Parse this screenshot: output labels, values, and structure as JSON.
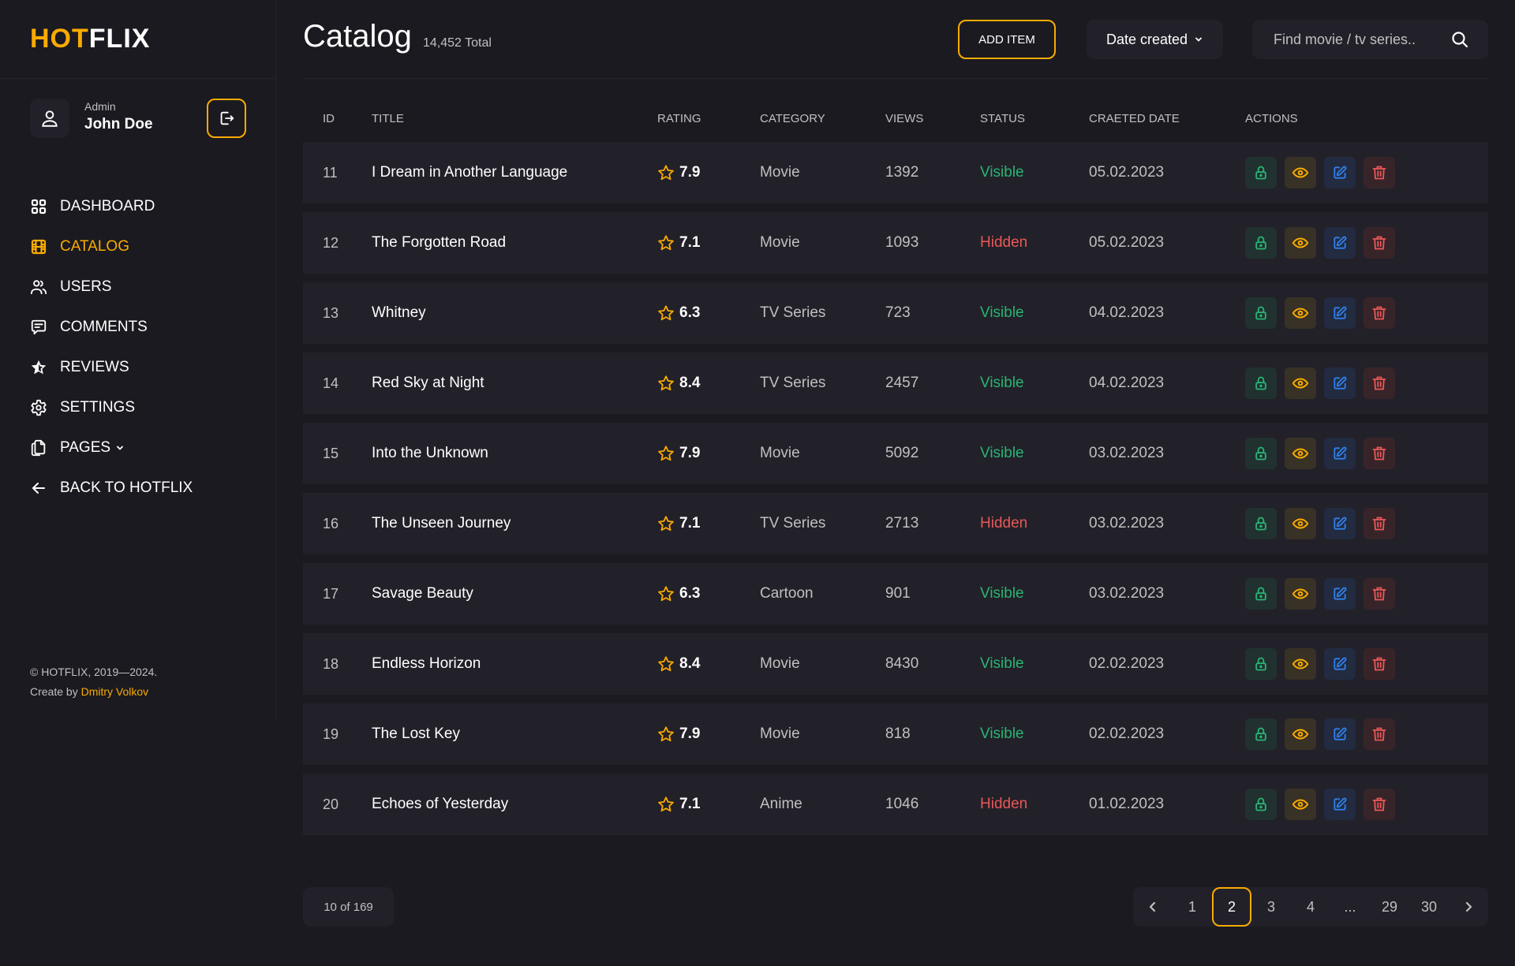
{
  "brand": {
    "part1": "HOT",
    "part2": "FLIX"
  },
  "user": {
    "role": "Admin",
    "name": "John Doe"
  },
  "nav": {
    "items": [
      {
        "label": "DASHBOARD",
        "icon": "dashboard-grid-icon",
        "active": false
      },
      {
        "label": "CATALOG",
        "icon": "film-icon",
        "active": true
      },
      {
        "label": "USERS",
        "icon": "users-icon",
        "active": false
      },
      {
        "label": "COMMENTS",
        "icon": "comment-icon",
        "active": false
      },
      {
        "label": "REVIEWS",
        "icon": "star-half-icon",
        "active": false
      },
      {
        "label": "SETTINGS",
        "icon": "gear-icon",
        "active": false
      },
      {
        "label": "PAGES",
        "icon": "pages-icon",
        "active": false,
        "dropdown": true
      },
      {
        "label": "BACK TO HOTFLIX",
        "icon": "arrow-left-icon",
        "active": false
      }
    ]
  },
  "footer": {
    "copyright": "© HOTFLIX, 2019—2024.",
    "created_prefix": "Create by ",
    "author": "Dmitry Volkov"
  },
  "header": {
    "title": "Catalog",
    "total": "14,452 Total",
    "add_button": "ADD ITEM",
    "sort": {
      "selected": "Date created"
    },
    "search": {
      "placeholder": "Find movie / tv series.."
    }
  },
  "colors": {
    "accent": "#f9ab00",
    "background": "#1b1a20",
    "surface": "#222129",
    "visible": "#29b474",
    "hidden": "#eb5757",
    "edit": "#2f80ed"
  },
  "table": {
    "columns": [
      "ID",
      "TITLE",
      "RATING",
      "CATEGORY",
      "VIEWS",
      "STATUS",
      "CRAETED DATE",
      "ACTIONS"
    ],
    "rows": [
      {
        "id": "11",
        "title": "I Dream in Another Language",
        "rating": "7.9",
        "category": "Movie",
        "views": "1392",
        "status": "Visible",
        "date": "05.02.2023"
      },
      {
        "id": "12",
        "title": "The Forgotten Road",
        "rating": "7.1",
        "category": "Movie",
        "views": "1093",
        "status": "Hidden",
        "date": "05.02.2023"
      },
      {
        "id": "13",
        "title": "Whitney",
        "rating": "6.3",
        "category": "TV Series",
        "views": "723",
        "status": "Visible",
        "date": "04.02.2023"
      },
      {
        "id": "14",
        "title": "Red Sky at Night",
        "rating": "8.4",
        "category": "TV Series",
        "views": "2457",
        "status": "Visible",
        "date": "04.02.2023"
      },
      {
        "id": "15",
        "title": "Into the Unknown",
        "rating": "7.9",
        "category": "Movie",
        "views": "5092",
        "status": "Visible",
        "date": "03.02.2023"
      },
      {
        "id": "16",
        "title": "The Unseen Journey",
        "rating": "7.1",
        "category": "TV Series",
        "views": "2713",
        "status": "Hidden",
        "date": "03.02.2023"
      },
      {
        "id": "17",
        "title": "Savage Beauty",
        "rating": "6.3",
        "category": "Cartoon",
        "views": "901",
        "status": "Visible",
        "date": "03.02.2023"
      },
      {
        "id": "18",
        "title": "Endless Horizon",
        "rating": "8.4",
        "category": "Movie",
        "views": "8430",
        "status": "Visible",
        "date": "02.02.2023"
      },
      {
        "id": "19",
        "title": "The Lost Key",
        "rating": "7.9",
        "category": "Movie",
        "views": "818",
        "status": "Visible",
        "date": "02.02.2023"
      },
      {
        "id": "20",
        "title": "Echoes of Yesterday",
        "rating": "7.1",
        "category": "Anime",
        "views": "1046",
        "status": "Hidden",
        "date": "01.02.2023"
      }
    ],
    "actions": [
      "lock",
      "view",
      "edit",
      "delete"
    ]
  },
  "pagination": {
    "counter": "10 of 169",
    "pages": [
      "1",
      "2",
      "3",
      "4",
      "...",
      "29",
      "30"
    ],
    "current": "2"
  }
}
